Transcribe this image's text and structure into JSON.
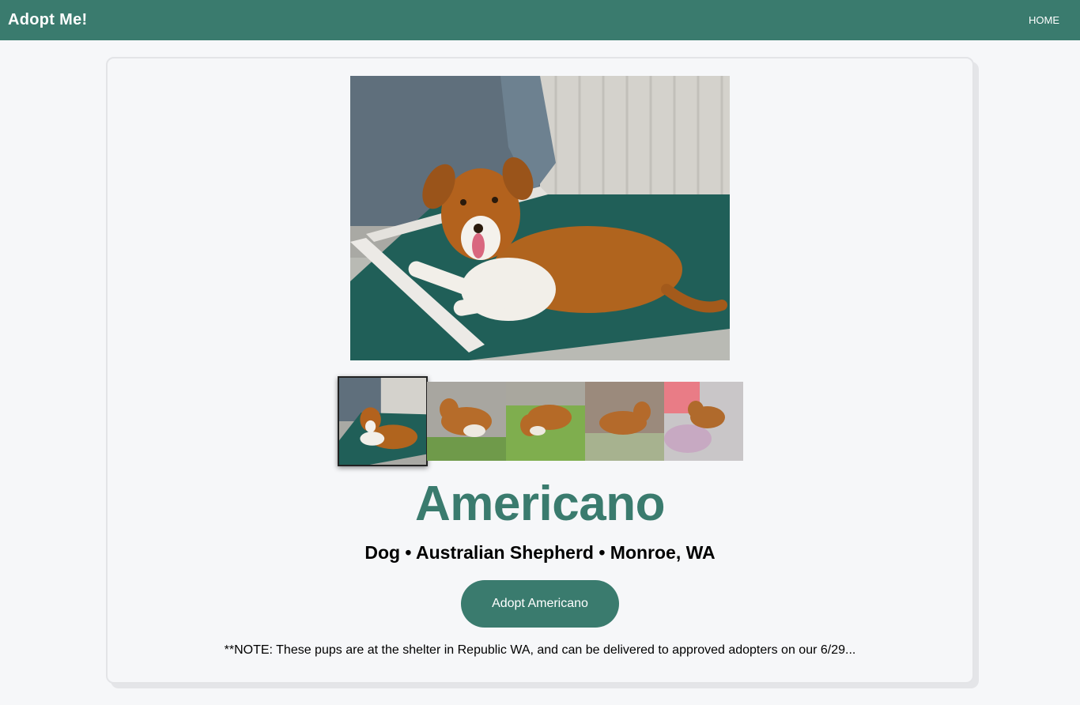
{
  "navbar": {
    "brand": "Adopt Me!",
    "links": [
      {
        "label": "HOME"
      }
    ]
  },
  "pet": {
    "name": "Americano",
    "details": "Dog • Australian Shepherd • Monroe, WA",
    "adopt_label": "Adopt Americano",
    "note": "**NOTE: These pups are at the shelter in Republic WA, and can be delivered to approved adopters on our 6/29..."
  },
  "gallery": {
    "selected_index": 0,
    "photo_count": 5
  },
  "colors": {
    "accent": "#3a7b6e",
    "page_background": "#f6f7f9",
    "header_text": "#ffffff"
  }
}
